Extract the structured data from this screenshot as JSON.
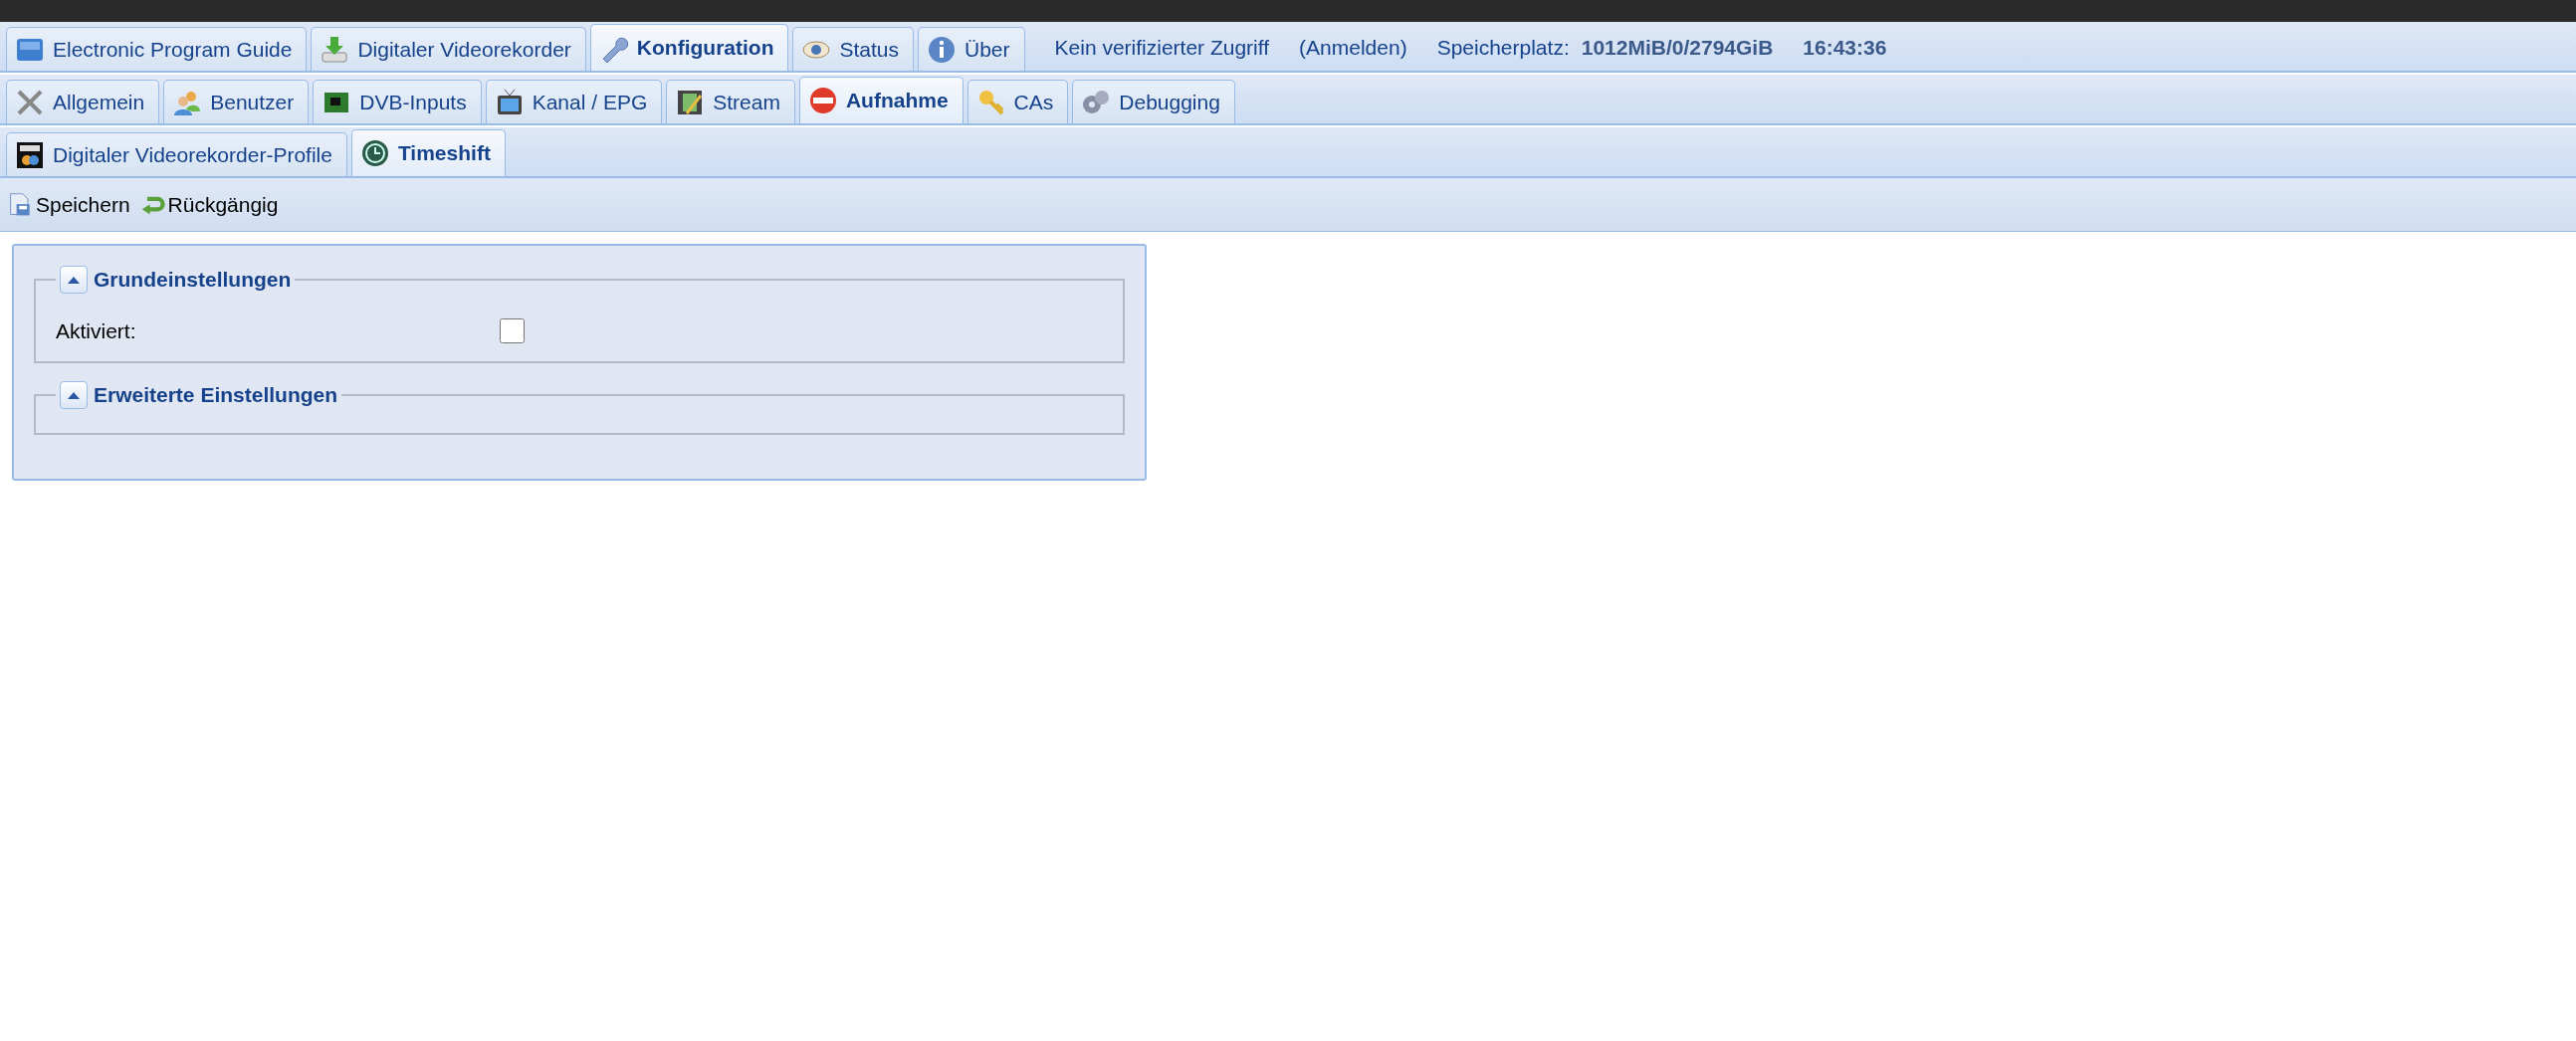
{
  "main_tabs": [
    {
      "label": "Electronic Program Guide",
      "selected": false
    },
    {
      "label": "Digitaler Videorekorder",
      "selected": false
    },
    {
      "label": "Konfiguration",
      "selected": true
    },
    {
      "label": "Status",
      "selected": false
    },
    {
      "label": "Über",
      "selected": false
    }
  ],
  "status": {
    "access": "Kein verifizierter Zugriff",
    "login": "(Anmelden)",
    "storage_label": "Speicherplatz:",
    "storage_value": "1012MiB/0/2794GiB",
    "time": "16:43:36"
  },
  "config_tabs": [
    {
      "label": "Allgemein",
      "selected": false
    },
    {
      "label": "Benutzer",
      "selected": false
    },
    {
      "label": "DVB-Inputs",
      "selected": false
    },
    {
      "label": "Kanal / EPG",
      "selected": false
    },
    {
      "label": "Stream",
      "selected": false
    },
    {
      "label": "Aufnahme",
      "selected": true
    },
    {
      "label": "CAs",
      "selected": false
    },
    {
      "label": "Debugging",
      "selected": false
    }
  ],
  "recording_tabs": [
    {
      "label": "Digitaler Videorekorder-Profile",
      "selected": false
    },
    {
      "label": "Timeshift",
      "selected": true
    }
  ],
  "toolbar": [
    {
      "label": "Speichern"
    },
    {
      "label": "Rückgängig"
    }
  ],
  "fieldsets": [
    {
      "title": "Grundeinstellungen",
      "expanded": true,
      "fields": [
        {
          "label": "Aktiviert:",
          "kind": "checkbox",
          "checked": false
        }
      ]
    },
    {
      "title": "Erweiterte Einstellungen",
      "expanded": true
    }
  ]
}
